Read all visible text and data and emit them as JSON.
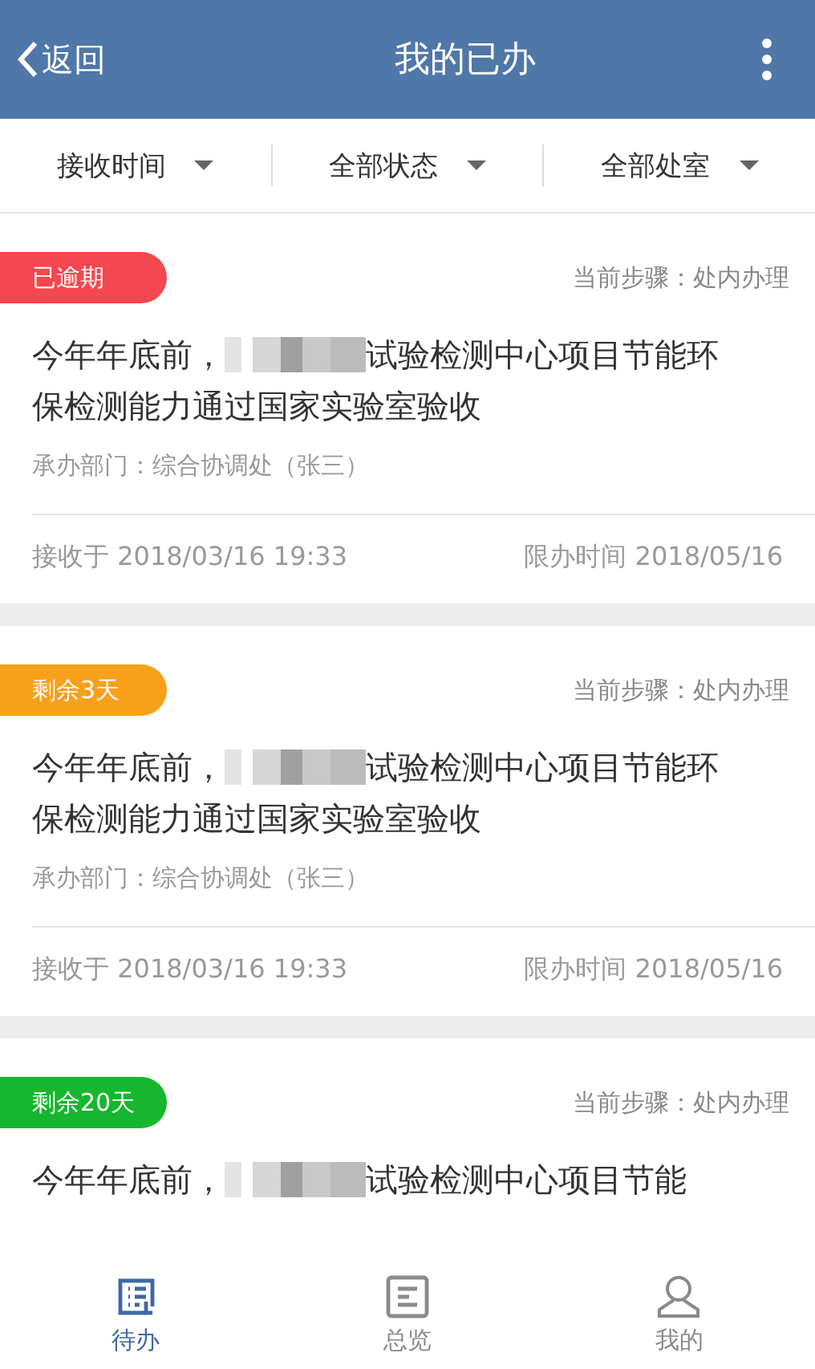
{
  "header": {
    "back": "返回",
    "title": "我的已办"
  },
  "filters": [
    {
      "label": "接收时间"
    },
    {
      "label": "全部状态"
    },
    {
      "label": "全部处室"
    }
  ],
  "tasks": [
    {
      "badge": "已逾期",
      "color": "#f5474f",
      "step": "当前步骤：处内办理",
      "title_prefix": "今年年底前，",
      "title_after_redaction": "试验检测中心项目节能环",
      "title_line_2": "保检测能力通过国家实验室验收",
      "department": "承办部门：综合协调处（张三）",
      "received": "接收于 2018/03/16 19:33",
      "deadline": "限办时间 2018/05/16"
    },
    {
      "badge": "剩余3天",
      "color": "#f9a01b",
      "step": "当前步骤：处内办理",
      "title_prefix": "今年年底前，",
      "title_after_redaction": "试验检测中心项目节能环",
      "title_line_2": "保检测能力通过国家实验室验收",
      "department": "承办部门：综合协调处（张三）",
      "received": "接收于 2018/03/16 19:33",
      "deadline": "限办时间 2018/05/16"
    },
    {
      "badge": "剩余20天",
      "color": "#17b62f",
      "step": "当前步骤：处内办理",
      "title_prefix": "今年年底前，",
      "title_after_redaction": "试验检测中心项目节能"
    }
  ],
  "tabbar": [
    {
      "label": "待办",
      "kind": "list",
      "selected": true
    },
    {
      "label": "总览",
      "kind": "doc",
      "selected": false
    },
    {
      "label": "我的",
      "kind": "user",
      "selected": false
    }
  ]
}
